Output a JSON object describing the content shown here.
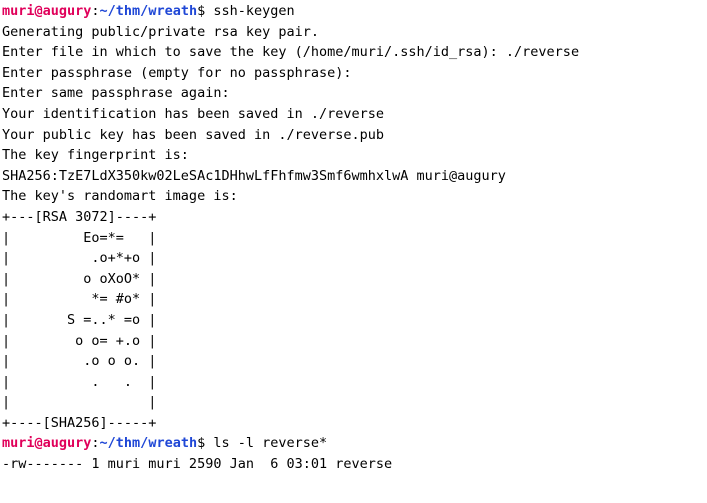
{
  "terminal": {
    "prompt": {
      "user_host": "muri@augury",
      "colon": ":",
      "path": "~/thm/wreath",
      "symbol": "$ "
    },
    "commands": {
      "first": "ssh-keygen",
      "second": "ls -l reverse*"
    },
    "output": [
      "Generating public/private rsa key pair.",
      "Enter file in which to save the key (/home/muri/.ssh/id_rsa): ./reverse",
      "Enter passphrase (empty for no passphrase):",
      "Enter same passphrase again:",
      "Your identification has been saved in ./reverse",
      "Your public key has been saved in ./reverse.pub",
      "The key fingerprint is:",
      "SHA256:TzE7LdX350kw02LeSAc1DHhwLfFhfmw3Smf6wmhxlwA muri@augury",
      "The key's randomart image is:",
      "+---[RSA 3072]----+",
      "|         Eo=*=   |",
      "|          .o+*+o |",
      "|         o oXoO* |",
      "|          *= #o* |",
      "|       S =..* =o |",
      "|        o o= +.o |",
      "|         .o o o. |",
      "|          .   .  |",
      "|                 |",
      "+----[SHA256]-----+"
    ],
    "ls_output": "-rw------- 1 muri muri 2590 Jan  6 03:01 reverse"
  },
  "colors": {
    "user_host": "#e0005a",
    "path": "#1f47d6",
    "text": "#000000",
    "background": "#ffffff"
  }
}
